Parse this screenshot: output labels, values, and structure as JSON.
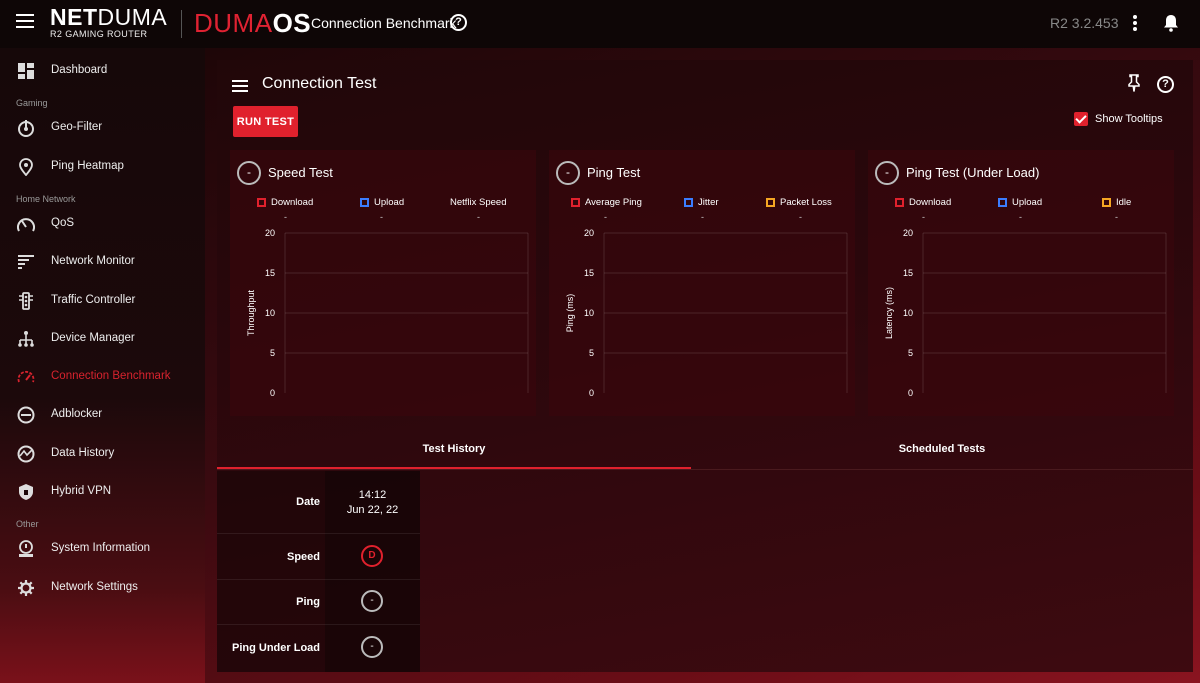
{
  "topbar": {
    "brand_bold": "NET",
    "brand_thin": "DUMA",
    "brand_sub": "R2 GAMING ROUTER",
    "os_part1": "DUMA",
    "os_part2": "OS",
    "page_heading": "Connection Benchmark",
    "help_glyph": "?",
    "version": "R2 3.2.453",
    "icons": [
      "menu-icon",
      "help-icon",
      "more-vert-icon",
      "bell-icon"
    ]
  },
  "sidebar": {
    "sections": {
      "gaming": "Gaming",
      "home": "Home Network",
      "other": "Other"
    },
    "items": [
      {
        "label": "Dashboard",
        "icon": "dashboard-icon"
      },
      {
        "label": "Geo-Filter",
        "icon": "geo-filter-icon"
      },
      {
        "label": "Ping Heatmap",
        "icon": "ping-heatmap-icon"
      },
      {
        "label": "QoS",
        "icon": "qos-icon"
      },
      {
        "label": "Network Monitor",
        "icon": "network-monitor-icon"
      },
      {
        "label": "Traffic Controller",
        "icon": "traffic-controller-icon"
      },
      {
        "label": "Device Manager",
        "icon": "device-manager-icon"
      },
      {
        "label": "Connection Benchmark",
        "icon": "speedometer-icon",
        "active": true
      },
      {
        "label": "Adblocker",
        "icon": "adblocker-icon"
      },
      {
        "label": "Data History",
        "icon": "data-history-icon"
      },
      {
        "label": "Hybrid VPN",
        "icon": "shield-icon"
      },
      {
        "label": "System Information",
        "icon": "system-info-icon"
      },
      {
        "label": "Network Settings",
        "icon": "gear-icon"
      }
    ],
    "accent_color": "#d8232e"
  },
  "panel": {
    "title": "Connection Test",
    "run_button": "RUN TEST",
    "show_tooltips": "Show Tooltips",
    "show_tooltips_checked": true,
    "help_glyph": "?"
  },
  "cards": [
    {
      "title": "Speed Test",
      "toggle": "-",
      "legend": [
        {
          "label": "Download",
          "color": "#e0212d",
          "value": "-"
        },
        {
          "label": "Upload",
          "color": "#3b7dff",
          "value": "-"
        },
        {
          "label": "Netflix Speed",
          "color": "",
          "value": "-"
        }
      ]
    },
    {
      "title": "Ping Test",
      "toggle": "-",
      "legend": [
        {
          "label": "Average Ping",
          "color": "#e0212d",
          "value": "-"
        },
        {
          "label": "Jitter",
          "color": "#3b7dff",
          "value": "-"
        },
        {
          "label": "Packet Loss",
          "color": "#f5a623",
          "value": "-"
        }
      ]
    },
    {
      "title": "Ping Test (Under Load)",
      "toggle": "-",
      "legend": [
        {
          "label": "Download",
          "color": "#e0212d",
          "value": "-"
        },
        {
          "label": "Upload",
          "color": "#3b7dff",
          "value": "-"
        },
        {
          "label": "Idle",
          "color": "#f5a623",
          "value": "-"
        }
      ]
    }
  ],
  "chart_data": [
    {
      "type": "line",
      "ylabel": "Throughput",
      "yticks": [
        "20",
        "15",
        "10",
        "5",
        "0"
      ],
      "ylim": [
        0,
        20
      ],
      "series": []
    },
    {
      "type": "line",
      "ylabel": "Ping (ms)",
      "yticks": [
        "20",
        "15",
        "10",
        "5",
        "0"
      ],
      "ylim": [
        0,
        20
      ],
      "series": []
    },
    {
      "type": "line",
      "ylabel": "Latency (ms)",
      "yticks": [
        "20",
        "15",
        "10",
        "5",
        "0"
      ],
      "ylim": [
        0,
        20
      ],
      "series": []
    }
  ],
  "tabs": {
    "history": "Test History",
    "scheduled": "Scheduled Tests"
  },
  "history": {
    "row_labels": {
      "date": "Date",
      "speed": "Speed",
      "ping": "Ping",
      "ping_load": "Ping Under Load"
    },
    "entry": {
      "time": "14:12",
      "date": "Jun 22, 22",
      "speed": "D",
      "ping": "-",
      "ping_load": "-"
    }
  }
}
